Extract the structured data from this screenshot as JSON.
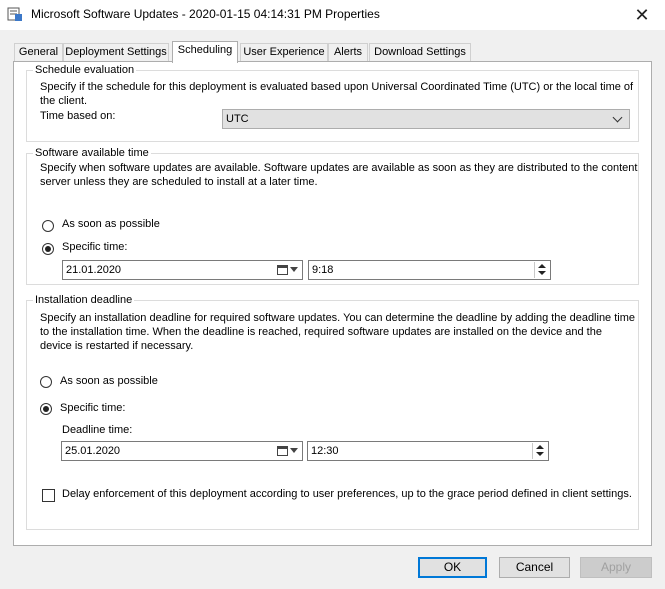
{
  "window": {
    "title": "Microsoft Software Updates - 2020-01-15 04:14:31 PM Properties",
    "close_glyph": "✕"
  },
  "tabs": [
    {
      "label": "General"
    },
    {
      "label": "Deployment Settings"
    },
    {
      "label": "Scheduling"
    },
    {
      "label": "User Experience"
    },
    {
      "label": "Alerts"
    },
    {
      "label": "Download Settings"
    }
  ],
  "active_tab": "Scheduling",
  "schedule_evaluation": {
    "title": "Schedule evaluation",
    "desc_line1": "Specify if the schedule for this deployment is evaluated based upon Universal Coordinated Time (UTC) or the local time of",
    "desc_line2": "the client.",
    "time_based_label": "Time based on:",
    "time_based_value": "UTC"
  },
  "software_available": {
    "title": "Software available time",
    "desc_line1": "Specify when software updates are available. Software updates are available as soon as they are distributed to the content",
    "desc_line2": "server unless they are scheduled to install at a later time.",
    "asap_label": "As soon as possible",
    "specific_label": "Specific time:",
    "selected": "specific",
    "date_value": "21.01.2020",
    "time_value": "9:18"
  },
  "installation_deadline": {
    "title": "Installation deadline",
    "desc_line1": "Specify an installation deadline for required software updates. You can determine the deadline by adding the deadline time",
    "desc_line2": "to the installation time. When the deadline is reached, required software updates are installed on the device and the",
    "desc_line3": "device is restarted if necessary.",
    "asap_label": "As soon as possible",
    "specific_label": "Specific time:",
    "selected": "specific",
    "deadline_label": "Deadline time:",
    "date_value": "25.01.2020",
    "time_value": "12:30",
    "delay_label": "Delay enforcement of this deployment according to user preferences, up to the grace period defined in client settings.",
    "delay_checked": false
  },
  "buttons": {
    "ok": "OK",
    "cancel": "Cancel",
    "apply": "Apply"
  }
}
